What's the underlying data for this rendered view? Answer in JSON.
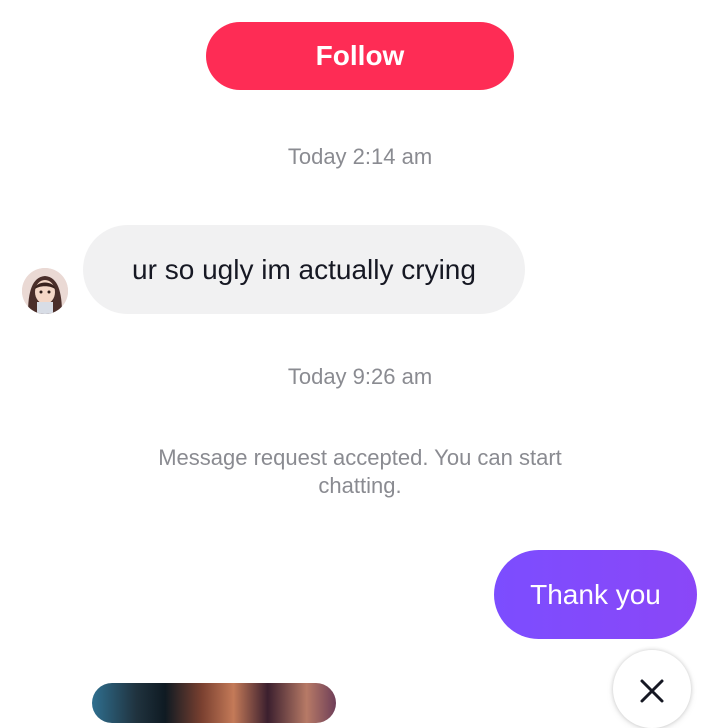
{
  "header": {
    "follow_label": "Follow"
  },
  "messages": [
    {
      "timestamp": "Today 2:14 am",
      "text": "ur so ugly im actually crying",
      "direction": "incoming"
    },
    {
      "timestamp": "Today 9:26 am",
      "system_text": "Message request accepted. You can start chatting."
    },
    {
      "text": "Thank you",
      "direction": "outgoing"
    }
  ],
  "icons": {
    "avatar": "user-avatar",
    "close": "close-icon"
  },
  "colors": {
    "follow_button": "#fe2c55",
    "incoming_bubble": "#f1f1f2",
    "outgoing_bubble": "#7c4dff",
    "timestamp_text": "#8a8b91"
  }
}
